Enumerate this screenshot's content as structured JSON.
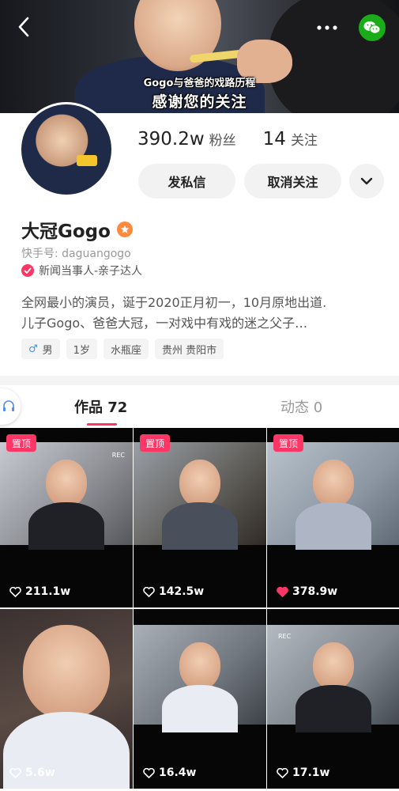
{
  "banner": {
    "caption_small": "Gogo与爸爸的戏路历程",
    "caption_large": "感谢您的关注",
    "back_icon": "chevron-left-icon",
    "more_icon": "more-dots-icon",
    "share_icon": "wechat-icon",
    "share_color": "#1aad19"
  },
  "profile": {
    "followers_count": "390.2w",
    "followers_label": "粉丝",
    "following_count": "14",
    "following_label": "关注",
    "message_button": "发私信",
    "unfollow_button": "取消关注",
    "name": "大冠Gogo",
    "kuaishou_id": "快手号: daguangogo",
    "tag_text": "新闻当事人-亲子达人",
    "bio_line1": "全网最小的演员，诞于2020正月初一，10月原地出道.",
    "bio_line2": "儿子Gogo、爸爸大冠，一对戏中有戏的迷之父子…",
    "chips": [
      "男",
      "1岁",
      "水瓶座",
      "贵州 贵阳市"
    ],
    "accent_color": "#fe3666"
  },
  "tabs": {
    "works_label": "作品 72",
    "moments_label": "动态 0"
  },
  "videos": [
    {
      "pinned_label": "置顶",
      "likes": "211.1w",
      "liked": false,
      "rec": "REC"
    },
    {
      "pinned_label": "置顶",
      "likes": "142.5w",
      "liked": false
    },
    {
      "pinned_label": "置顶",
      "likes": "378.9w",
      "liked": true
    },
    {
      "likes": "5.6w",
      "liked": false
    },
    {
      "likes": "16.4w",
      "liked": false
    },
    {
      "likes": "17.1w",
      "liked": false,
      "rec": "REC"
    }
  ]
}
